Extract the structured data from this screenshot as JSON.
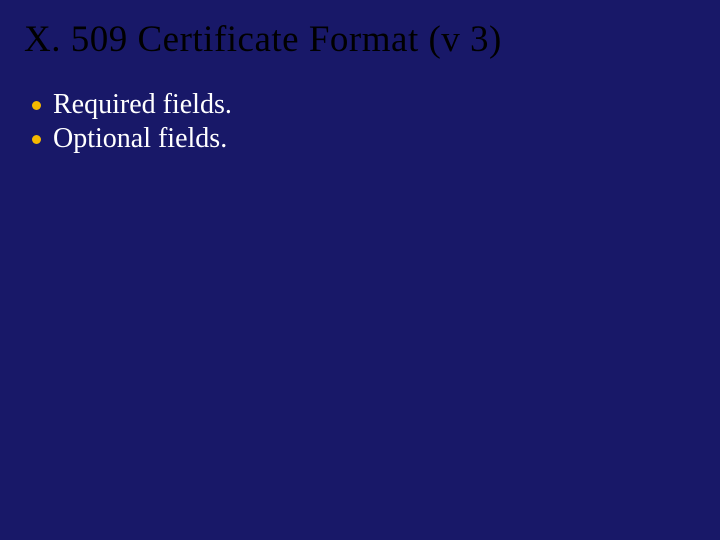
{
  "slide": {
    "title": "X. 509 Certificate Format (v 3)",
    "bullets": [
      {
        "text": "Required fields."
      },
      {
        "text": "Optional fields."
      }
    ]
  },
  "colors": {
    "background": "#181868",
    "title": "#000000",
    "bullet_dot": "#f5b800",
    "bullet_text": "#ffffff"
  }
}
